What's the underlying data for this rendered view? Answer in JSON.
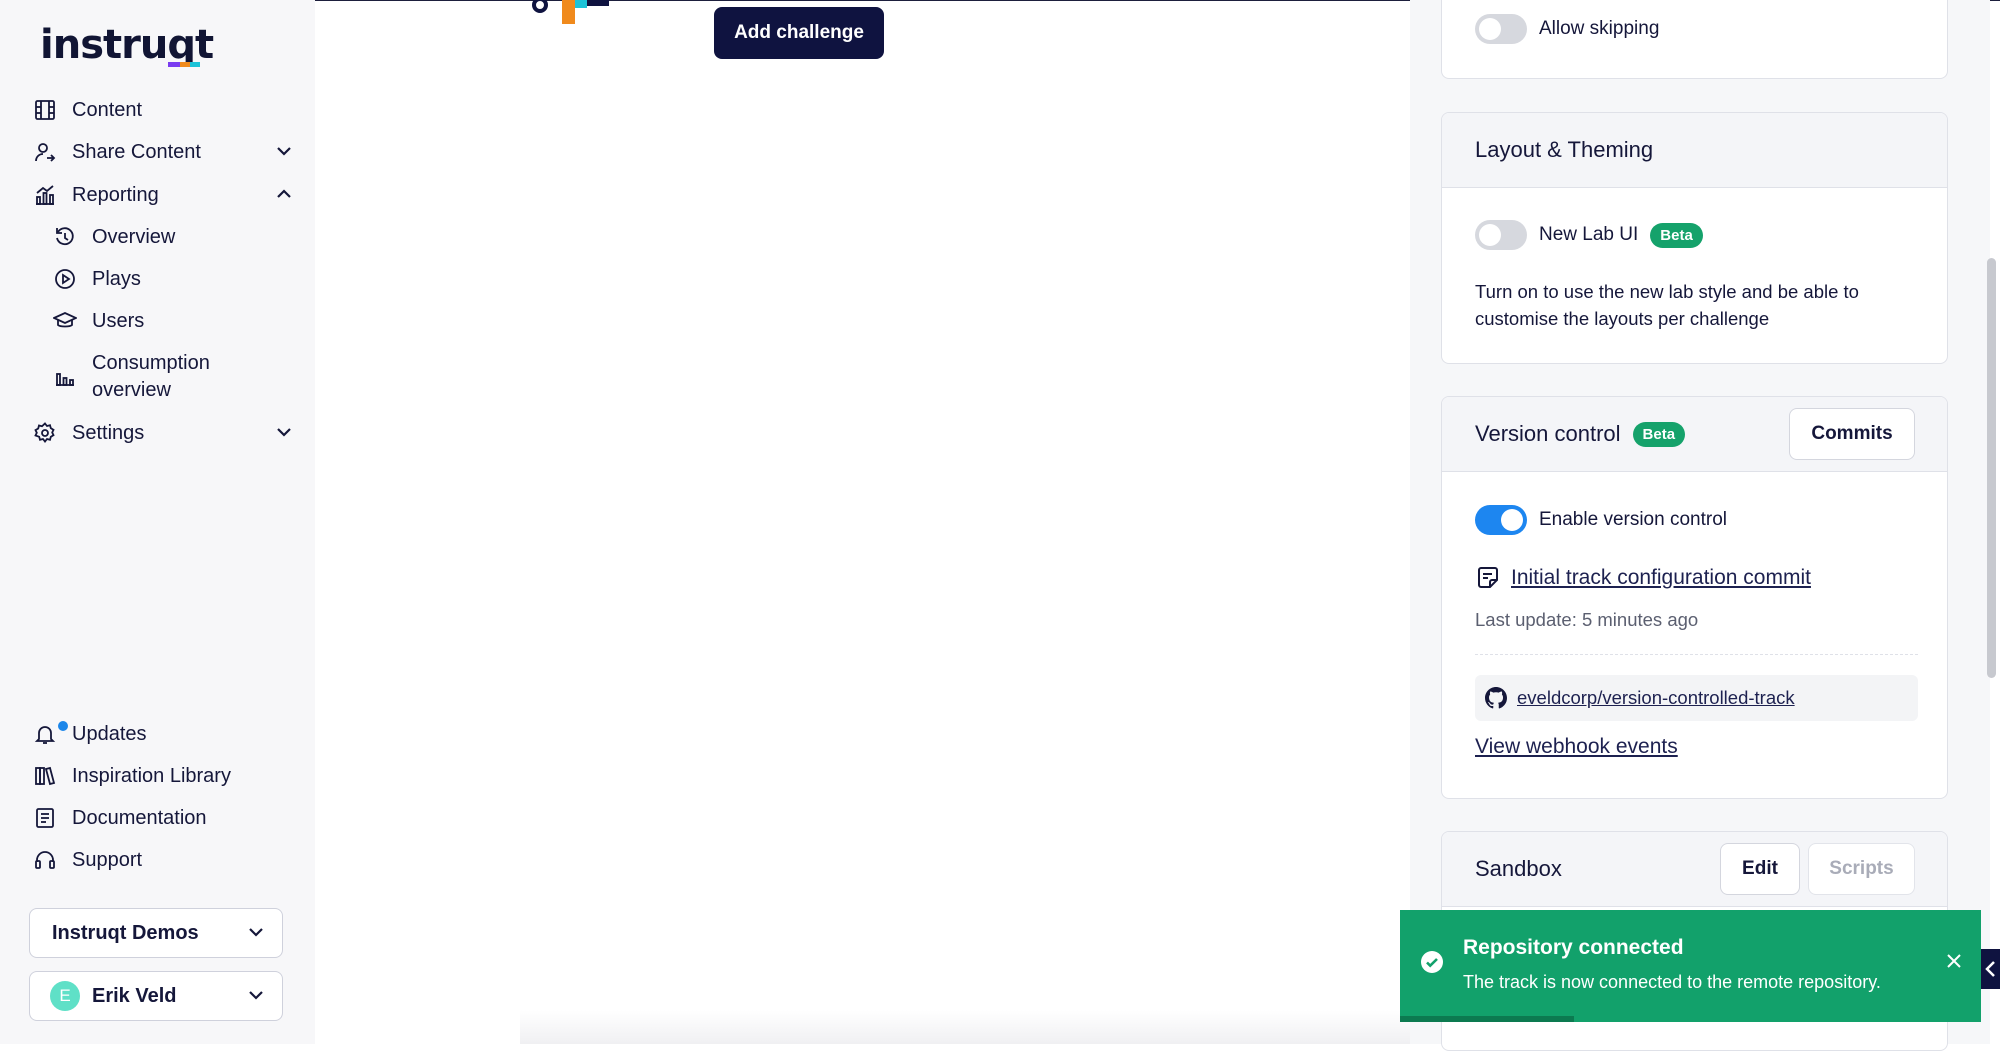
{
  "brand": {
    "logo_text": "instruqt"
  },
  "sidebar": {
    "nav": [
      {
        "label": "Content",
        "icon": "film-grid-icon"
      },
      {
        "label": "Share Content",
        "icon": "user-share-icon"
      },
      {
        "label": "Reporting",
        "icon": "bar-chart-icon"
      }
    ],
    "reporting_sub": [
      {
        "label": "Overview",
        "icon": "history-icon"
      },
      {
        "label": "Plays",
        "icon": "play-circle-icon"
      },
      {
        "label": "Users",
        "icon": "graduation-cap-icon"
      },
      {
        "label_line1": "Consumption",
        "label_line2": "overview",
        "icon": "column-chart-icon"
      }
    ],
    "settings": {
      "label": "Settings",
      "icon": "gear-icon"
    },
    "bottom": [
      {
        "label": "Updates",
        "icon": "bell-icon"
      },
      {
        "label": "Inspiration Library",
        "icon": "books-icon"
      },
      {
        "label": "Documentation",
        "icon": "document-icon"
      },
      {
        "label": "Support",
        "icon": "headset-icon"
      }
    ],
    "org_select": "Instruqt Demos",
    "user": {
      "initial": "E",
      "name": "Erik Veld"
    }
  },
  "main": {
    "add_challenge": "Add challenge"
  },
  "right": {
    "allow_skipping": {
      "label": "Allow skipping",
      "on": false
    },
    "layout": {
      "title": "Layout & Theming",
      "toggle_label": "New Lab UI",
      "badge": "Beta",
      "on": false,
      "desc_line1": "Turn on to use the new lab style and be able to",
      "desc_line2": "customise the layouts per challenge"
    },
    "version_control": {
      "title": "Version control",
      "badge": "Beta",
      "commits_button": "Commits",
      "toggle_label": "Enable version control",
      "on": true,
      "commit_link": "Initial track configuration commit",
      "last_update": "Last update: 5 minutes ago",
      "repo": "eveldcorp/version-controlled-track",
      "webhook_link": "View webhook events"
    },
    "sandbox": {
      "title": "Sandbox",
      "edit_button": "Edit",
      "scripts_button": "Scripts"
    }
  },
  "toast": {
    "title": "Repository connected",
    "message": "The track is now connected to the remote repository.",
    "progress": 0.3
  },
  "colors": {
    "accent": "#1d86f0",
    "success": "#12a16b",
    "dark": "#0f1340",
    "beta": "#15a26b"
  }
}
